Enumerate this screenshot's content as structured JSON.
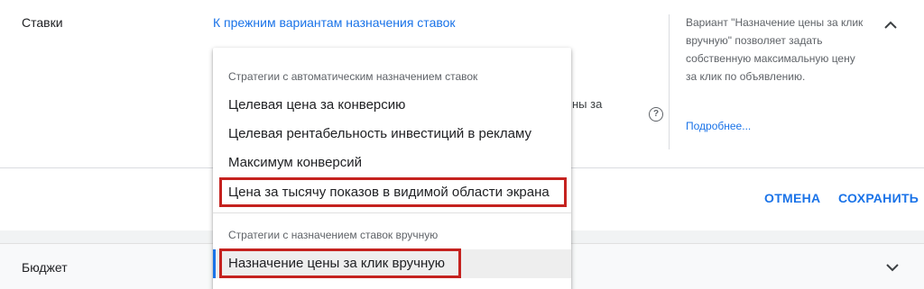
{
  "bids": {
    "section_label": "Ставки",
    "legacy_link": "К прежним вариантам назначения ставок",
    "partial_hidden_text": "ны за",
    "help_icon_glyph": "?",
    "side_help_text": "Вариант \"Назначение цены за клик вручную\" позволяет задать собственную максимальную цену за клик по объявлению.",
    "side_help_more": "Подробнее...",
    "collapse_icon": "chevron-up-icon"
  },
  "actions": {
    "cancel_label": "ОТМЕНА",
    "save_label": "СОХРАНИТЬ"
  },
  "budget": {
    "label": "Бюджет",
    "expand_icon": "chevron-down-icon"
  },
  "menu": {
    "auto_group_title": "Стратегии с автоматическим назначением ставок",
    "auto_items": [
      "Целевая цена за конверсию",
      "Целевая рентабельность инвестиций в рекламу",
      "Максимум конверсий",
      "Цена за тысячу показов в видимой области экрана"
    ],
    "manual_group_title": "Стратегии с назначением ставок вручную",
    "manual_items": [
      "Назначение цены за клик вручную"
    ],
    "selected_item": "Назначение цены за клик вручную"
  },
  "colors": {
    "accent": "#1a73e8",
    "highlight": "#c5221f",
    "text": "#202124",
    "muted": "#5f6368"
  }
}
